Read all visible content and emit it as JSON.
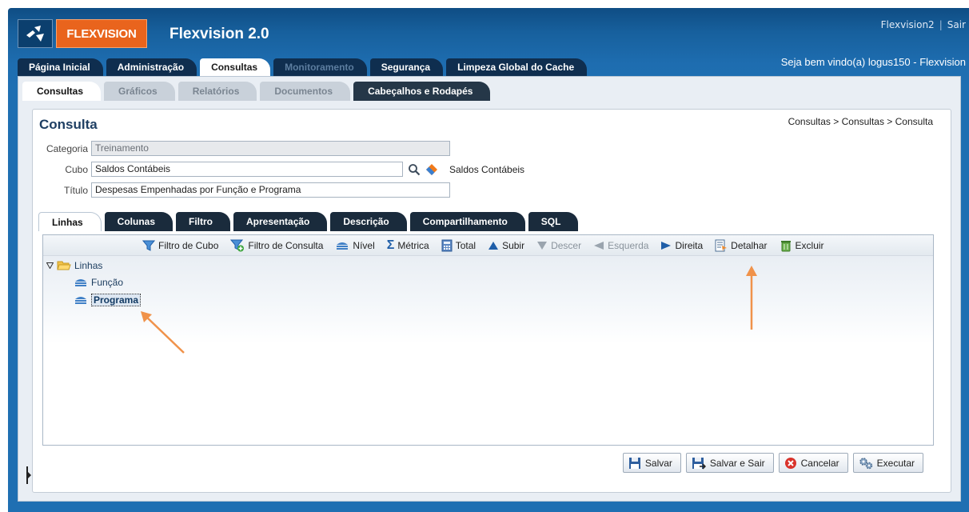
{
  "app": {
    "logo_text": "FLEXVISION",
    "title": "Flexvision 2.0"
  },
  "top_links": {
    "user": "Flexvision2",
    "logout": "Sair"
  },
  "welcome": "Seja bem vindo(a) logus150 - Flexvision",
  "main_tabs": [
    "Página Inicial",
    "Administração",
    "Consultas",
    "Monitoramento",
    "Segurança",
    "Limpeza Global do Cache"
  ],
  "sub_tabs": [
    "Consultas",
    "Gráficos",
    "Relatórios",
    "Documentos",
    "Cabeçalhos e Rodapés"
  ],
  "page": {
    "title": "Consulta",
    "breadcrumb": "Consultas > Consultas > Consulta"
  },
  "form": {
    "categoria_label": "Categoria",
    "categoria_value": "Treinamento",
    "cubo_label": "Cubo",
    "cubo_value": "Saldos Contábeis",
    "cubo_desc": "Saldos Contábeis",
    "titulo_label": "Título",
    "titulo_value": "Despesas Empenhadas por Função e Programa"
  },
  "inner_tabs": [
    "Linhas",
    "Colunas",
    "Filtro",
    "Apresentação",
    "Descrição",
    "Compartilhamento",
    "SQL"
  ],
  "toolbar": [
    "Filtro de Cubo",
    "Filtro de Consulta",
    "Nível",
    "Métrica",
    "Total",
    "Subir",
    "Descer",
    "Esquerda",
    "Direita",
    "Detalhar",
    "Excluir"
  ],
  "tree": {
    "root": "Linhas",
    "children": [
      "Função",
      "Programa"
    ]
  },
  "buttons": [
    "Salvar",
    "Salvar e Sair",
    "Cancelar",
    "Executar"
  ],
  "colors": {
    "header_blue": "#1f6fb2",
    "logo_orange": "#e9641d",
    "annotation_arrow": "#f0924a"
  }
}
